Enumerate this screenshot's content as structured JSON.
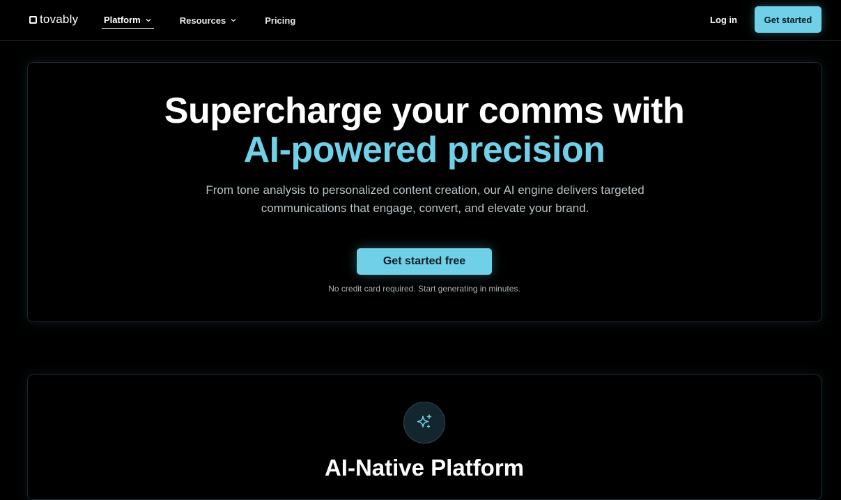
{
  "brand": {
    "name": "tovably"
  },
  "nav": {
    "items": [
      {
        "label": "Platform",
        "has_dropdown": true,
        "active": true
      },
      {
        "label": "Resources",
        "has_dropdown": true,
        "active": false
      },
      {
        "label": "Pricing",
        "has_dropdown": false,
        "active": false
      }
    ],
    "login_label": "Log in",
    "cta_label": "Get started"
  },
  "hero": {
    "title_line1": "Supercharge your comms with",
    "title_line2": "AI-powered precision",
    "subtitle": "From tone analysis to personalized content creation, our AI engine delivers targeted communications that engage, convert, and elevate your brand.",
    "cta_label": "Get started free",
    "note": "No credit card required. Start generating in minutes."
  },
  "feature": {
    "icon": "sparkles-icon",
    "title": "AI-Native Platform"
  },
  "colors": {
    "accent": "#6fd0e8",
    "background": "#000000",
    "text": "#ffffff",
    "muted": "#b9c3c8"
  }
}
